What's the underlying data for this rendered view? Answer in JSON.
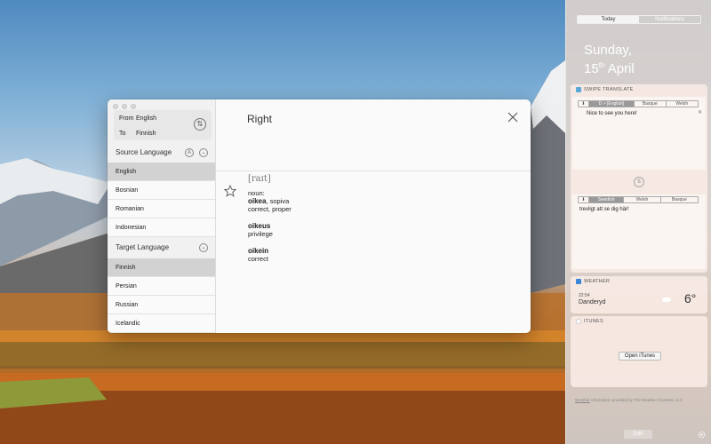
{
  "window": {
    "from_label": "From",
    "from_value": "English",
    "to_label": "To",
    "to_value": "Finnish",
    "source_heading": "Source Language",
    "source_items": [
      "English",
      "Bosnian",
      "Romanian",
      "Indonesian"
    ],
    "target_heading": "Target Language",
    "target_items": [
      "Finnish",
      "Persian",
      "Russian",
      "Icelandic"
    ],
    "word": "Right",
    "phonetic": "[raɪt]",
    "pos": "noun:",
    "def1_bold": "oikea",
    "def1_rest": ", sopiva",
    "def1_gloss": "correct, proper",
    "def2_bold": "oikeus",
    "def2_gloss": "privilege",
    "def3_bold": "oikein",
    "def3_gloss": "correct"
  },
  "nc": {
    "tab_today": "Today",
    "tab_notifications": "Notifications",
    "date_day": "Sunday,",
    "date_num": "15",
    "date_suffix": "th",
    "date_month": "April",
    "swipe_title": "SWIPE TRANSLATE",
    "top_tabs": [
      "D > [English]",
      "Basque",
      "Welsh"
    ],
    "top_text": "Nice to see you here!",
    "bottom_tabs": [
      "Swedish",
      "Welsh",
      "Basque"
    ],
    "bottom_text": "trevligt att se dig här!",
    "weather_title": "WEATHER",
    "weather_time": "22:54",
    "weather_city": "Danderyd",
    "weather_temp": "6°",
    "itunes_title": "ITUNES",
    "open_itunes": "Open iTunes",
    "footer_link": "Weather",
    "footer_rest": " information provided by The Weather Channel, LLC",
    "edit": "Edit"
  }
}
